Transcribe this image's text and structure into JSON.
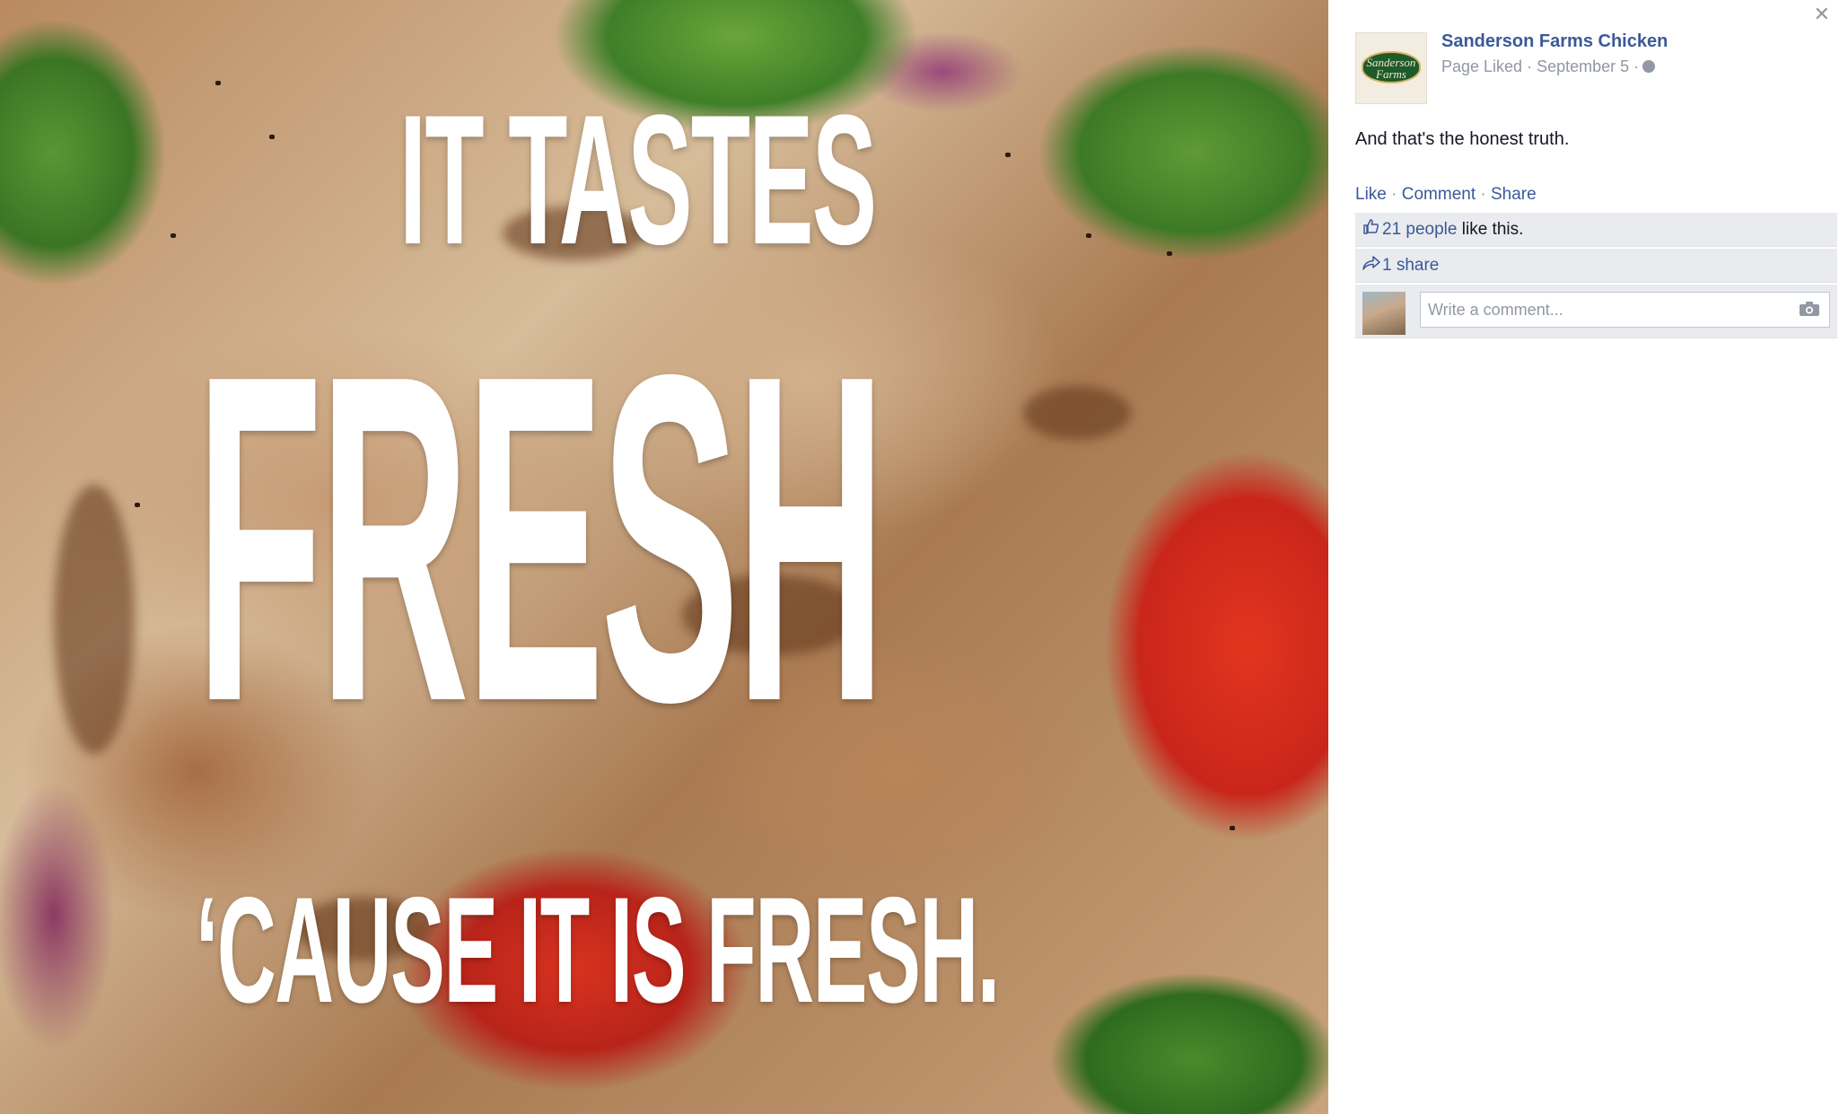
{
  "photo": {
    "headline": {
      "line1": "IT TASTES",
      "line2": "FRESH",
      "line3": "‘CAUSE IT IS FRESH."
    }
  },
  "panel": {
    "close_icon": "close-icon",
    "page_name": "Sanderson Farms Chicken",
    "logo_text": "Sanderson Farms",
    "meta": "Page Liked · September 5 ·",
    "privacy_icon": "globe-icon",
    "post_text": "And that's the honest truth.",
    "actions": {
      "like": "Like",
      "comment": "Comment",
      "share": "Share",
      "separator": " · "
    },
    "likes": {
      "icon": "thumbs-up-icon",
      "people_link": "21 people",
      "suffix": " like this."
    },
    "shares": {
      "icon": "share-icon",
      "text": "1 share"
    },
    "comment_placeholder": "Write a comment...",
    "camera_icon": "camera-icon"
  },
  "colors": {
    "link": "#3b5998",
    "meta": "#9197a3",
    "ufi_background": "#e9ebee",
    "text": "#141823"
  }
}
